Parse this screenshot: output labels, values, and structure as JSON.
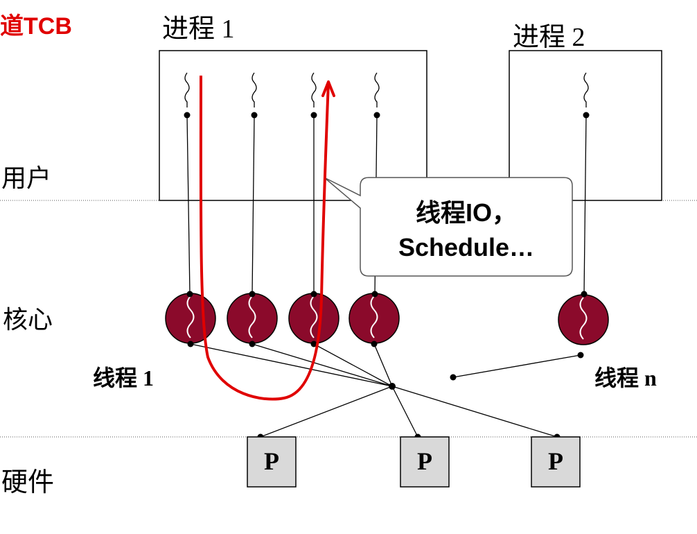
{
  "top_left_label": "道TCB",
  "process1": {
    "title": "进程 1"
  },
  "process2": {
    "title": "进程 2"
  },
  "layers": {
    "user": "用户",
    "kernel": "核心",
    "hardware": "硬件"
  },
  "callout": {
    "line1": "线程IO，",
    "line2": "Schedule…"
  },
  "thread_labels": {
    "first": "线程 1",
    "last": "线程 n"
  },
  "processors": [
    "P",
    "P",
    "P"
  ],
  "colors": {
    "kernel_thread": "#8b0a2b",
    "flow_arrow": "#e00000",
    "processor_fill": "#d9d9d9"
  }
}
